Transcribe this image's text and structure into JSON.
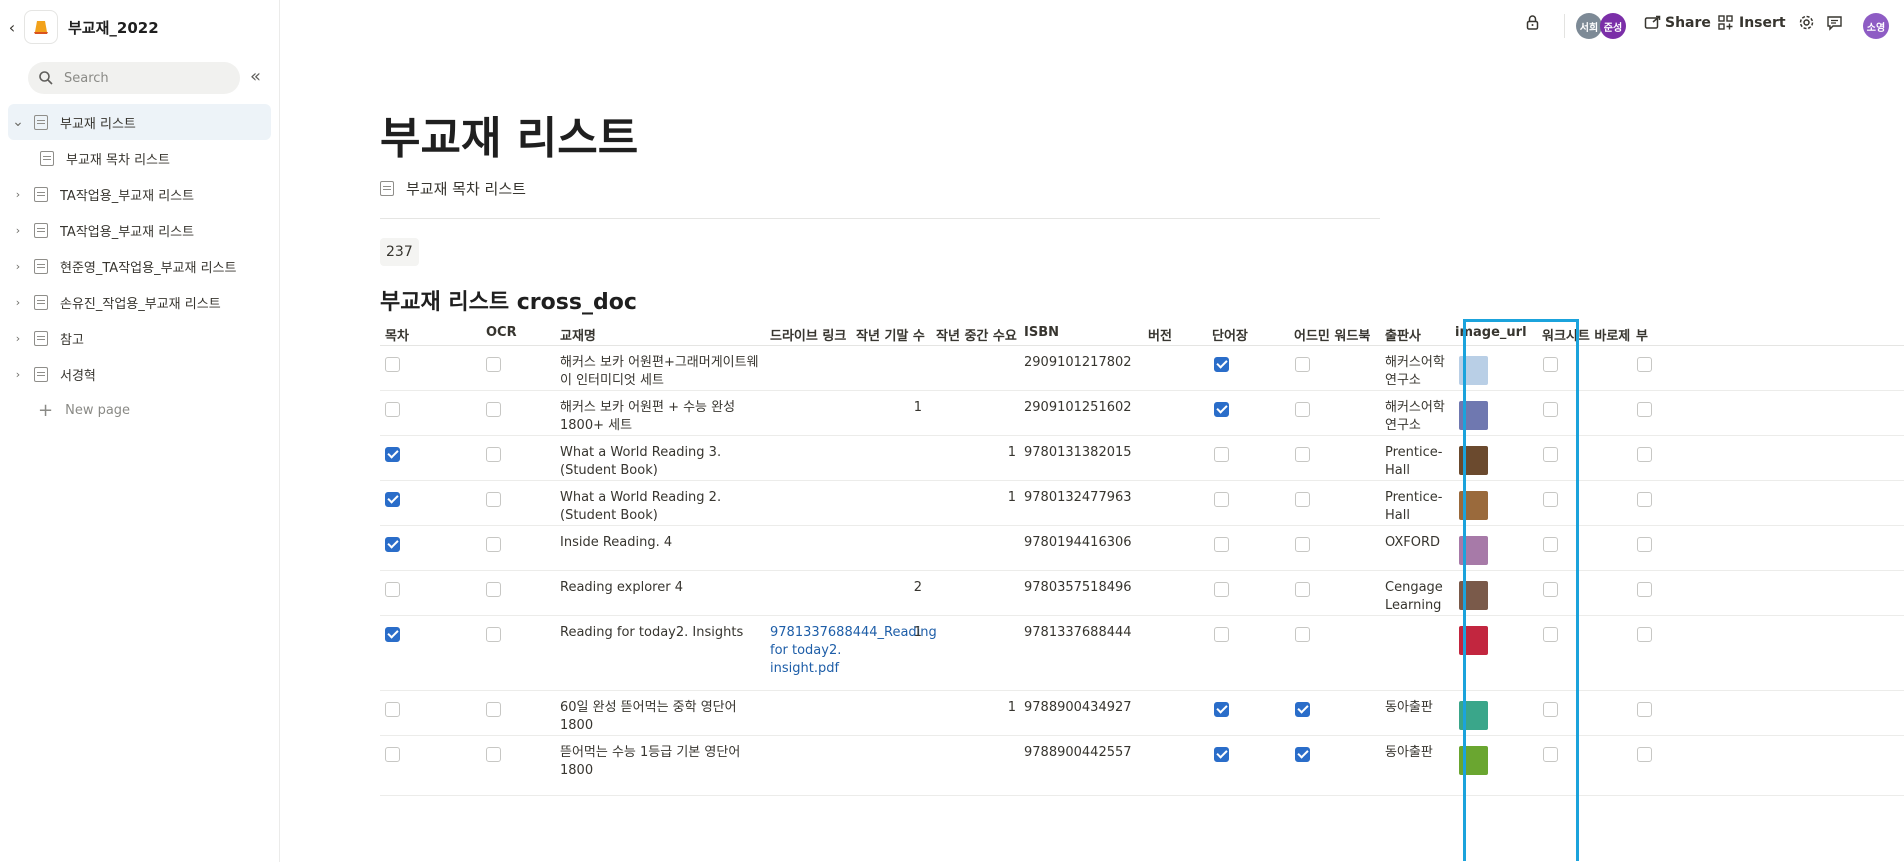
{
  "sidebar": {
    "workspace_name": "부교재_2022",
    "search_placeholder": "Search",
    "items": [
      {
        "label": "부교재 리스트",
        "expanded": true,
        "active": true
      },
      {
        "label": "부교재 목차 리스트",
        "child": true
      },
      {
        "label": "TA작업용_부교재 리스트"
      },
      {
        "label": "TA작업용_부교재 리스트"
      },
      {
        "label": "현준영_TA작업용_부교재 리스트"
      },
      {
        "label": "손유진_작업용_부교재 리스트"
      },
      {
        "label": "참고"
      },
      {
        "label": "서경혁"
      }
    ],
    "new_page_label": "New page"
  },
  "topbar": {
    "avatars": [
      {
        "text": "서희",
        "color": "#7d8a96"
      },
      {
        "text": "준성",
        "color": "#7b2fa8"
      }
    ],
    "share_label": "Share",
    "insert_label": "Insert",
    "user_avatar": {
      "text": "소영",
      "color": "#8e5cc4"
    }
  },
  "page": {
    "title": "부교재 리스트",
    "subpage_label": "부교재 목차 리스트",
    "count": "237",
    "db_title": "부교재 리스트 cross_doc"
  },
  "table": {
    "headers": [
      "목차",
      "OCR",
      "교재명",
      "드라이브 링크",
      "작년 기말 수",
      "작년 중간 수요",
      "ISBN",
      "버전",
      "단어장",
      "어드민 워드북",
      "출판사",
      "image_url",
      "워크시트 바로제",
      "부"
    ],
    "rows": [
      {
        "toc": false,
        "ocr": false,
        "name": "해커스 보카 어원편+그래머게이트웨이 인터미디엇 세트",
        "drive": "",
        "last_final": "",
        "last_mid": "",
        "isbn": "2909101217802",
        "vocab": true,
        "admin": false,
        "publisher": "해커스어학연구소",
        "img": "#b9cfe6",
        "ws": false
      },
      {
        "toc": false,
        "ocr": false,
        "name": "해커스 보카 어원편 + 수능 완성 1800+ 세트",
        "drive": "",
        "last_final": "1",
        "last_mid": "",
        "isbn": "2909101251602",
        "vocab": true,
        "admin": false,
        "publisher": "해커스어학연구소",
        "img": "#6f78b0",
        "ws": false
      },
      {
        "toc": true,
        "ocr": false,
        "name": "What a World Reading 3. (Student Book)",
        "drive": "",
        "last_final": "",
        "last_mid": "1",
        "isbn": "9780131382015",
        "vocab": false,
        "admin": false,
        "publisher": "Prentice-Hall",
        "img": "#6b4a2e",
        "ws": false
      },
      {
        "toc": true,
        "ocr": false,
        "name": "What a World Reading 2. (Student Book)",
        "drive": "",
        "last_final": "",
        "last_mid": "1",
        "isbn": "9780132477963",
        "vocab": false,
        "admin": false,
        "publisher": "Prentice-Hall",
        "img": "#9a6a3c",
        "ws": false
      },
      {
        "toc": true,
        "ocr": false,
        "name": "Inside Reading. 4",
        "drive": "",
        "last_final": "",
        "last_mid": "",
        "isbn": "9780194416306",
        "vocab": false,
        "admin": false,
        "publisher": "OXFORD",
        "img": "#a77aa8",
        "ws": false
      },
      {
        "toc": false,
        "ocr": false,
        "name": "Reading explorer 4",
        "drive": "",
        "last_final": "2",
        "last_mid": "",
        "isbn": "9780357518496",
        "vocab": false,
        "admin": false,
        "publisher": "Cengage Learning",
        "img": "#7a5a4a",
        "ws": false
      },
      {
        "toc": true,
        "ocr": false,
        "name": "Reading for today2. Insights",
        "drive": "9781337688444_Reading for today2. insight.pdf",
        "last_final": "1",
        "last_mid": "",
        "isbn": "9781337688444",
        "vocab": false,
        "admin": false,
        "publisher": "",
        "img": "#c2263f",
        "ws": false
      },
      {
        "toc": false,
        "ocr": false,
        "name": "60일 완성 뜯어먹는 중학 영단어 1800",
        "drive": "",
        "last_final": "",
        "last_mid": "1",
        "isbn": "9788900434927",
        "vocab": true,
        "admin": true,
        "publisher": "동아출판",
        "img": "#3aa68a",
        "ws": false
      },
      {
        "toc": false,
        "ocr": false,
        "name": "뜯어먹는 수능 1등급 기본 영단어 1800",
        "drive": "",
        "last_final": "",
        "last_mid": "",
        "isbn": "9788900442557",
        "vocab": true,
        "admin": true,
        "publisher": "동아출판",
        "img": "#6aa630",
        "ws": false
      }
    ]
  },
  "colors": {
    "accent": "#2a6dc9",
    "highlight": "#1ba3dc"
  }
}
